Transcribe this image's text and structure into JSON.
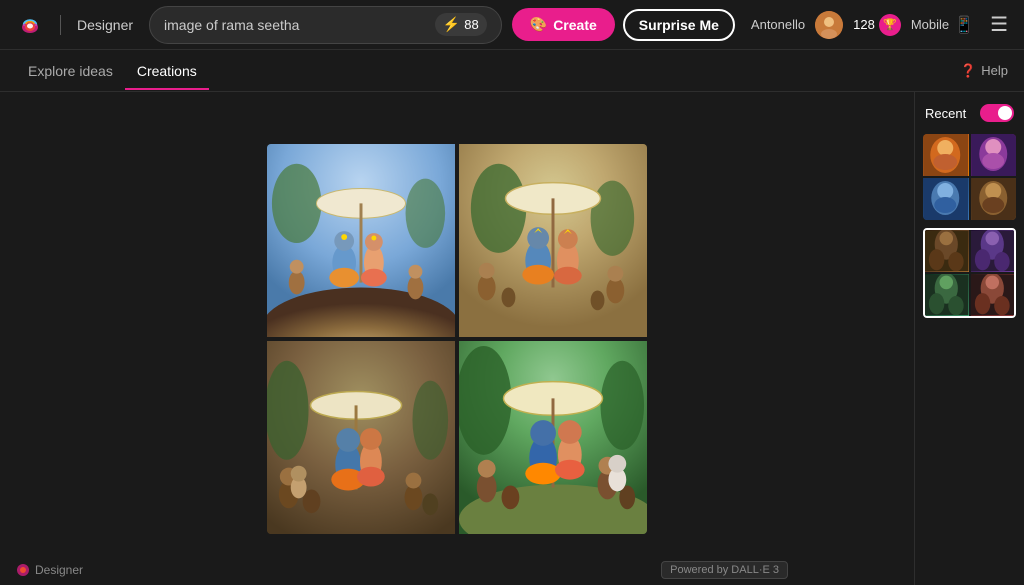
{
  "header": {
    "app_name": "Designer",
    "search_placeholder": "image of rama seetha",
    "search_value": "image of rama seetha",
    "boost_count": "88",
    "create_label": "Create",
    "surprise_label": "Surprise Me",
    "user_name": "Antonello",
    "coins": "128",
    "mobile_label": "Mobile",
    "help_label": "Help"
  },
  "nav": {
    "explore_label": "Explore ideas",
    "creations_label": "Creations"
  },
  "sidebar": {
    "recent_label": "Recent",
    "toggle_on": true
  },
  "footer": {
    "designer_label": "Designer",
    "powered_label": "Powered by DALL·E 3"
  }
}
